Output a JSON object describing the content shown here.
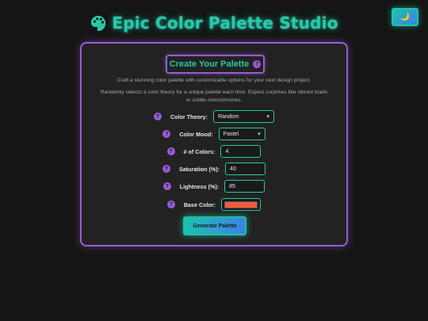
{
  "header": {
    "title": "Epic Color Palette Studio",
    "icon": "palette-icon",
    "theme_toggle_icon": "🌙"
  },
  "card": {
    "title": "Create Your Palette",
    "help_glyph": "?",
    "description": "Craft a stunning color palette with customizable options for your next design project.",
    "theory_note": "Randomly selects a color theory for a unique palette each time. Expect surprises like vibrant triads or subtle monochromes."
  },
  "form": {
    "color_theory": {
      "label": "Color Theory:",
      "value": "Random"
    },
    "color_mood": {
      "label": "Color Mood:",
      "value": "Pastel"
    },
    "num_colors": {
      "label": "# of Colors:",
      "value": "4"
    },
    "saturation": {
      "label": "Saturation (%):",
      "value": "40"
    },
    "lightness": {
      "label": "Lightness (%):",
      "value": "85"
    },
    "base_color": {
      "label": "Base Color:",
      "value": "#f05a3a"
    }
  },
  "actions": {
    "generate_label": "Generate Palette"
  },
  "colors": {
    "accent_teal": "#27c9a8",
    "accent_purple": "#9a5bd8",
    "background": "#151515",
    "card": "#222222"
  }
}
